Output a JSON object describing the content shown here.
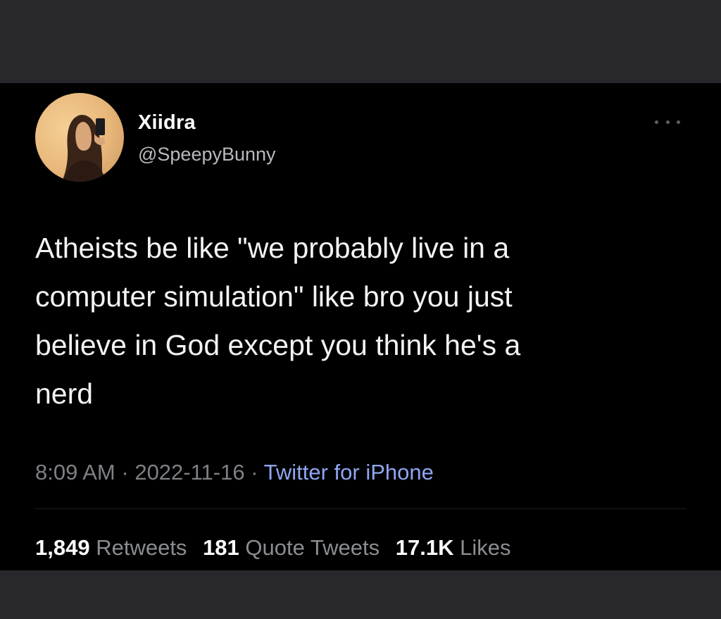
{
  "tweet": {
    "display_name": "Xiidra",
    "handle": "@SpeepyBunny",
    "text": "Atheists be like \"we probably live in a\ncomputer simulation\" like bro you just\nbelieve in God except you think he's a\nnerd",
    "time": "8:09 AM",
    "date": "2022-11-16",
    "separator": "·",
    "source": "Twitter for iPhone",
    "more_icon": "ellipsis-icon"
  },
  "stats": {
    "retweets_count": "1,849",
    "retweets_label": "Retweets",
    "quotes_count": "181",
    "quotes_label": "Quote Tweets",
    "likes_count": "17.1K",
    "likes_label": "Likes"
  },
  "colors": {
    "background": "#000000",
    "frame": "#28282c",
    "text": "#f3f3f3",
    "secondary": "#7d8084",
    "link": "#8fa6f1"
  }
}
